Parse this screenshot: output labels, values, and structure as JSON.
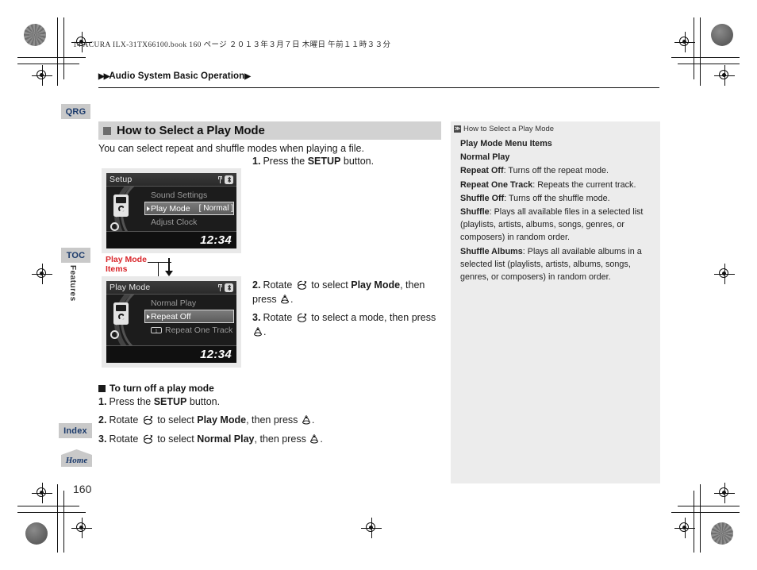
{
  "print_header": {
    "book_line": "14 ACURA ILX-31TX66100.book   160 ページ   ２０１３年３月７日   木曜日   午前１１時３３分"
  },
  "breadcrumb": {
    "prefix": "▶▶",
    "text": "Audio System Basic Operation",
    "suffix": "▶"
  },
  "side_tabs": {
    "qrg": "QRG",
    "toc": "TOC",
    "features": "Features",
    "index": "Index",
    "home": "Home"
  },
  "page_number": "160",
  "section": {
    "title": "How to Select a Play Mode",
    "intro": "You can select repeat and shuffle modes when playing a file."
  },
  "screens": [
    {
      "title": "Setup",
      "clock": "12:34",
      "rows": [
        {
          "label": "Sound Settings",
          "value": "",
          "selected": false,
          "icon": ""
        },
        {
          "label": "Play Mode",
          "value": "[ Normal ]",
          "selected": true,
          "icon": ""
        },
        {
          "label": "Adjust Clock",
          "value": "",
          "selected": false,
          "icon": ""
        }
      ]
    },
    {
      "title": "Play Mode",
      "clock": "12:34",
      "rows": [
        {
          "label": "Normal Play",
          "value": "",
          "selected": false,
          "icon": ""
        },
        {
          "label": "Repeat Off",
          "value": "",
          "selected": true,
          "icon": ""
        },
        {
          "label": "Repeat One Track",
          "value": "",
          "selected": false,
          "icon": "1"
        }
      ]
    }
  ],
  "callout": {
    "line1": "Play Mode",
    "line2": "Items"
  },
  "steps_main": [
    {
      "num": "1.",
      "html": "Press the <b>SETUP</b> button."
    },
    {
      "num": "2.",
      "html": "Rotate <span class=\"knob\" data-name=\"rotary-knob-icon\"></span> to select <b>Play Mode</b>, then press <span class=\"press\" data-name=\"press-knob-icon\"></span>."
    },
    {
      "num": "3.",
      "html": "Rotate <span class=\"knob\" data-name=\"rotary-knob-icon\"></span> to select a mode, then press <span class=\"press\" data-name=\"press-knob-icon\"></span>."
    }
  ],
  "subsection": {
    "title": "To turn off a play mode",
    "steps": [
      {
        "num": "1.",
        "html": "Press the <b>SETUP</b> button."
      },
      {
        "num": "2.",
        "html": "Rotate <span class=\"knob\" data-name=\"rotary-knob-icon\"></span> to select <b>Play Mode</b>, then press <span class=\"press\" data-name=\"press-knob-icon\"></span>."
      },
      {
        "num": "3.",
        "html": "Rotate <span class=\"knob\" data-name=\"rotary-knob-icon\"></span> to select <b>Normal Play</b>, then press <span class=\"press\" data-name=\"press-knob-icon\"></span>."
      }
    ]
  },
  "note": {
    "header": "How to Select a Play Mode",
    "header_mark": "≫",
    "lines": [
      {
        "html": "<b>Play Mode Menu Items</b>"
      },
      {
        "html": "<b>Normal Play</b>"
      },
      {
        "html": "<b>Repeat Off</b>: Turns off the repeat mode."
      },
      {
        "html": "<b>Repeat One Track</b>: Repeats the current track."
      },
      {
        "html": "<b>Shuffle Off</b>: Turns off the shuffle mode."
      },
      {
        "html": "<b>Shuffle</b>: Plays all available files in a selected list (playlists, artists, albums, songs, genres, or composers) in random order."
      },
      {
        "html": "<b>Shuffle Albums</b>: Plays all available albums in a selected list (playlists, artists, albums, songs, genres, or composers) in random order."
      }
    ]
  },
  "colors": {
    "callout_red": "#d9252a",
    "tab_blue": "#1b3a6b",
    "tab_gray": "#c9c9c9",
    "note_bg": "#ececec",
    "section_bg": "#d2d2d2"
  }
}
